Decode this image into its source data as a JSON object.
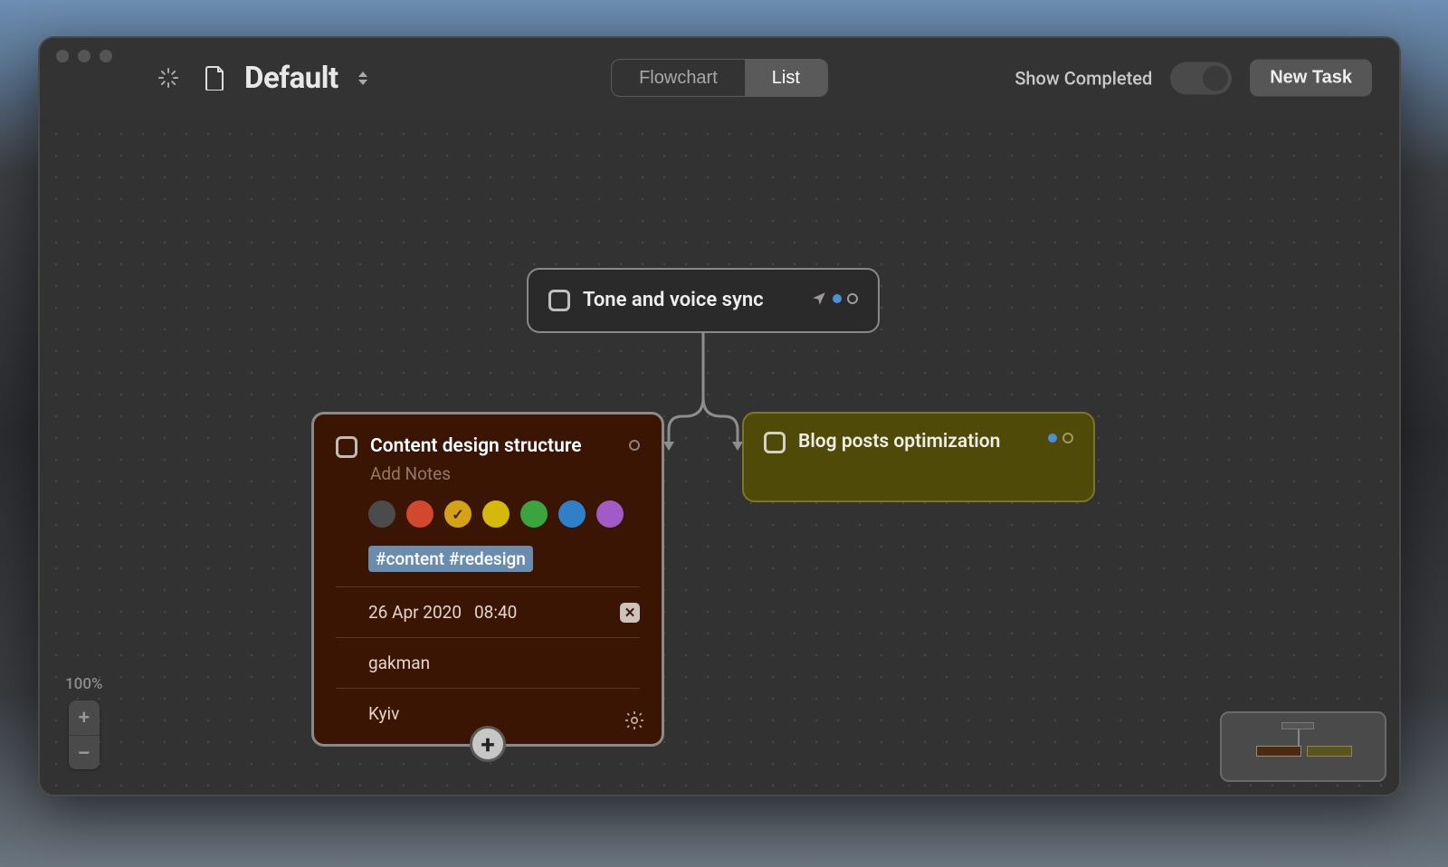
{
  "header": {
    "doc_title": "Default",
    "view_tabs": {
      "flowchart": "Flowchart",
      "list": "List",
      "active": "list"
    },
    "show_completed_label": "Show Completed",
    "show_completed": false,
    "new_task_label": "New Task"
  },
  "nodes": {
    "parent": {
      "title": "Tone and voice sync",
      "completed": false,
      "indicators": {
        "has_location": true,
        "dot_color": "#4d8fd6"
      }
    },
    "left": {
      "title": "Content design structure",
      "completed": false,
      "notes_placeholder": "Add Notes",
      "colors": [
        {
          "name": "gray",
          "hex": "#4b4b4b",
          "selected": false
        },
        {
          "name": "red",
          "hex": "#d0492d",
          "selected": false
        },
        {
          "name": "amber",
          "hex": "#d4a315",
          "selected": true
        },
        {
          "name": "yellow",
          "hex": "#d4b80a",
          "selected": false
        },
        {
          "name": "green",
          "hex": "#3aa53f",
          "selected": false
        },
        {
          "name": "blue",
          "hex": "#2f80c9",
          "selected": false
        },
        {
          "name": "purple",
          "hex": "#a15bc7",
          "selected": false
        }
      ],
      "tags": "#content #redesign",
      "due_date": "26 Apr 2020",
      "due_time": "08:40",
      "assignee": "gakman",
      "location": "Kyiv"
    },
    "right": {
      "title": "Blog posts optimization",
      "completed": false,
      "indicators": {
        "dot_color": "#4d8fd6"
      }
    }
  },
  "zoom": {
    "percent": "100%"
  }
}
